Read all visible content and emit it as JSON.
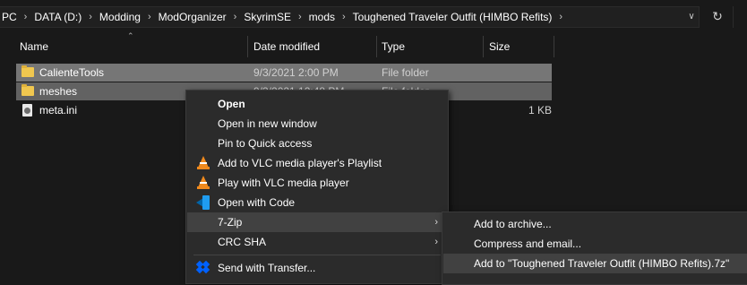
{
  "address_bar": {
    "crumbs": [
      "PC",
      "DATA (D:)",
      "Modding",
      "ModOrganizer",
      "SkyrimSE",
      "mods",
      "Toughened Traveler Outfit (HIMBO Refits)"
    ],
    "separator": "›",
    "dropdown_icon": "chevron-down-icon",
    "refresh_icon": "refresh-icon"
  },
  "columns": {
    "name": "Name",
    "date_modified": "Date modified",
    "type": "Type",
    "size": "Size"
  },
  "files": [
    {
      "name": "CalienteTools",
      "date": "9/3/2021 2:00 PM",
      "type": "File folder",
      "size": "",
      "icon": "folder-icon"
    },
    {
      "name": "meshes",
      "date": "9/3/2021 12:48 PM",
      "type": "File folder",
      "size": "",
      "icon": "folder-icon"
    },
    {
      "name": "meta.ini",
      "date": "",
      "type": "",
      "size": "1 KB",
      "icon": "settings-file-icon"
    }
  ],
  "context_menu": {
    "items": [
      {
        "label": "Open",
        "bold": true,
        "icon": ""
      },
      {
        "label": "Open in new window",
        "icon": ""
      },
      {
        "label": "Pin to Quick access",
        "icon": ""
      },
      {
        "label": "Add to VLC media player's Playlist",
        "icon": "vlc-icon"
      },
      {
        "label": "Play with VLC media player",
        "icon": "vlc-icon"
      },
      {
        "label": "Open with Code",
        "icon": "vscode-icon"
      },
      {
        "label": "7-Zip",
        "icon": "",
        "submenu": true
      },
      {
        "label": "CRC SHA",
        "icon": "",
        "submenu": true
      },
      {
        "label": "Send with Transfer...",
        "icon": "dropbox-icon"
      }
    ],
    "submenu_arrow": "›"
  },
  "submenu_7zip": {
    "items": [
      {
        "label": "Add to archive..."
      },
      {
        "label": "Compress and email..."
      },
      {
        "label": "Add to \"Toughened Traveler Outfit (HIMBO Refits).7z\""
      }
    ]
  },
  "colors": {
    "background": "#191919",
    "selection": "#767676",
    "menu_background": "#2b2b2b",
    "menu_hover": "#414141",
    "folder": "#f0c74f"
  }
}
